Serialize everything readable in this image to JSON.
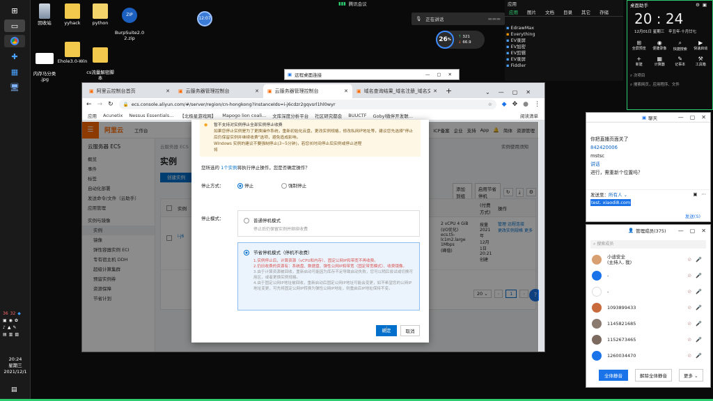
{
  "taskbar": {
    "clock_time": "20:24",
    "clock_day": "星期三",
    "clock_date": "2021/12/1",
    "tray_numbers": [
      "36",
      "32"
    ]
  },
  "desktop": {
    "icons": [
      {
        "label": "回收站",
        "icon": "recycle-bin-icon"
      },
      {
        "label": "yyhack",
        "icon": "folder-icon"
      },
      {
        "label": "python",
        "icon": "folder-icon"
      },
      {
        "label": "BurpSuite2.0\n2.zip",
        "icon": "zip-icon"
      },
      {
        "label": "内存马分类\n.jpg",
        "icon": "image-icon"
      },
      {
        "label": "Ehole3.0-Win",
        "icon": "folder-icon"
      },
      {
        "label": "cs流量解密脚\n本",
        "icon": "folder-icon"
      }
    ],
    "clock_bubble": "12:07"
  },
  "top_bar": {
    "tencent_meeting": "腾讯会议",
    "recording": "正在讲话"
  },
  "net_widget": {
    "cpu": "26",
    "up": "321",
    "down": "66.9"
  },
  "small_window": {
    "title": "远程桌面连接"
  },
  "browser": {
    "tabs": [
      {
        "label": "阿里云控制台首页"
      },
      {
        "label": "云服务器管理控制台"
      },
      {
        "label": "云服务器管理控制台"
      },
      {
        "label": "域名查询结果_域名注册_域名交易"
      }
    ],
    "url": "ecs.console.aliyun.com/#/server/region/cn-hongkong?instanceIds=i-j6cdzr2gqvsrl1hl0wyr",
    "bookmarks": [
      "应用",
      "Acunetix",
      "Nessus Essentials...",
      "【北极星游戏网】",
      "Mapogo lion coali...",
      "文库深度分析平台",
      "社区研究都会",
      "BUUCTF",
      "Gobyl微伴开发联...",
      "阅读清单"
    ],
    "page": {
      "logo": "阿里云",
      "workbench": "工作台",
      "search_placeholder": "搜索",
      "top_right": [
        "费用",
        "工单",
        "ICP备案",
        "企业",
        "支持",
        "App",
        "简体",
        "资源管理"
      ],
      "sidebar_title": "云服务器 ECS",
      "sidebar": [
        "概览",
        "事件",
        "标签",
        "自动化部署",
        "发送命令/文件（云助手）",
        "应用管理",
        "实例与镜像",
        "实例",
        "镜像",
        "弹性容器实例 ECI",
        "专有宿主机 DDH",
        "超级计算集群",
        "预留实例券",
        "资源保障",
        "节省计划"
      ],
      "breadcrumb": "云服务器 ECS",
      "page_title": "实例",
      "create_button": "创建实例",
      "right_link": "实例使用须知",
      "toolbar_buttons": [
        "添加到组",
        "启用节省停机"
      ],
      "table_header_cells": [
        "实例",
        "(付费方式)",
        "操作"
      ],
      "row_cells": {
        "spec": "2 vCPU 4 GiB\n(I/O优化)\necs.t5-lc1m2.large\n1Mbps\n(峰值)",
        "billing": "按量\n2021年\n12月\n1日\n20:21\n创建",
        "actions": [
          "管理",
          "远程连接",
          "更改实例规格",
          "更多"
        ]
      },
      "pagination": {
        "per_page": "20",
        "current_page": "1"
      }
    }
  },
  "modal": {
    "notice_lines": [
      "暂不支持对实例停止全部实例停止收费",
      "如果您停止实例是为了更换操作系统，重新初始化云盘，更改实例规格，修改私网IP地址等，建议您先选择\"停止后仍保留实例并继续收费\"选项，避免造成影响。",
      "Windows 实例的建议不要强制停止(3~5分钟)，若您长时间停止后实例或停止进程",
      "将"
    ],
    "selection_text_prefix": "您所选的 ",
    "selection_link": "1个实例",
    "selection_text_suffix": "将执行停止操作，您是否确定操作？",
    "stop_method_label": "停止方式：",
    "stop_method_options": [
      "停止",
      "强制停止"
    ],
    "stop_mode_label": "停止模式：",
    "mode_keep_title": "普通停机模式",
    "mode_keep_desc": "停止后仍保留实例并继续收费",
    "mode_save_title": "节省停机模式（停机不收费）",
    "mode_save_items": [
      "1.实例停止后，计算资源（vCPU和内存）、固定公网IP和带宽不再收费。",
      "2.仍旧收费的资源有：系统盘、数据盘、弹性公网IP和带宽（固定带宽模式）、收费镜像。",
      "3.由于计算资源被回收，重新启动可能因为库存不足导致启动失败，您可以稍后尝试或切换可用区，或者更换实例规格。",
      "4.由于固定公网IP地址被回收，重新启动后固定公网IP地址可能会变更，如不希望您的公网IP地址变更，可先将固定公网IP转换为弹性公网IP地址，则重启后IP地址保持不变。"
    ],
    "confirm_button": "确定",
    "cancel_button": "取消"
  },
  "search_panel": {
    "tabs": [
      "应用",
      "图片",
      "文档",
      "目录",
      "其它",
      "存储"
    ],
    "results": [
      "EdrawMax",
      "Everything",
      "EV录屏",
      "EV加密",
      "EV剪辑",
      "EV录屏",
      "Fiddler"
    ]
  },
  "clock_panel": {
    "title": "桌面助手",
    "time": "20 : 24",
    "date": "12月01日  星期三",
    "lunar": "辛丑年·十月廿七",
    "actions": [
      "全屏预览",
      "便捷录像",
      "快捷搜索",
      "快速启动",
      "新建",
      "计算器",
      "记事本",
      "工具箱"
    ],
    "search_placeholder": "次项目",
    "second_placeholder": "搜索网页，应用程序、文件"
  },
  "chat_panel": {
    "title": "聊天",
    "messages": [
      {
        "text": "你把直播页面关了",
        "color": "#111"
      },
      {
        "text": "842420006",
        "color": "#0b63c4"
      },
      {
        "text": "mstsc",
        "color": "#111"
      },
      {
        "text": "讲话",
        "color": "#0b63c4"
      },
      {
        "text": "进行，需重新个位置吗？",
        "color": "#111"
      }
    ],
    "send_to_label": "发送至：",
    "send_to_value": "所有人",
    "input_text": "test. xiaodi8.com",
    "send_button": "发送(S)"
  },
  "members_panel": {
    "title": "管理成员(375)",
    "search_placeholder": "搜索成员",
    "members": [
      {
        "name": "小迪安全\n(主持人, 我)",
        "color": "#d8a070"
      },
      {
        "name": "-",
        "color": "#1a73e8"
      },
      {
        "name": "-",
        "color": "#ffffff"
      },
      {
        "name": "1093899433",
        "color": "#c86a3c"
      },
      {
        "name": "1145821685",
        "color": "#8a7a70"
      },
      {
        "name": "1152673465",
        "color": "#7c6a60"
      },
      {
        "name": "1260034470",
        "color": "#1a73e8"
      }
    ],
    "buttons": [
      "全体静音",
      "解除全体静音",
      "更多"
    ]
  }
}
